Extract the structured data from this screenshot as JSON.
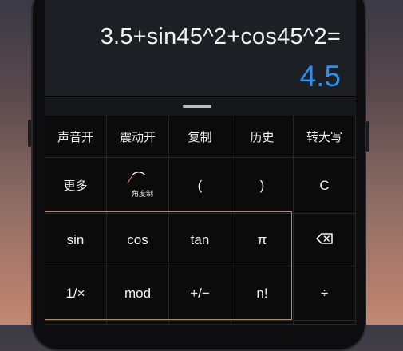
{
  "display": {
    "expression": "3.5+sin45^2+cos45^2=",
    "result": "4.5"
  },
  "toolbar": [
    "声音开",
    "震动开",
    "复制",
    "历史",
    "转大写"
  ],
  "row2": {
    "more": "更多",
    "angle_label": "角度制",
    "paren_open": "(",
    "paren_close": ")",
    "clear": "C"
  },
  "row3": {
    "sin": "sin",
    "cos": "cos",
    "tan": "tan",
    "pi": "π",
    "backspace": "⌫"
  },
  "row4": {
    "reciprocal": "1/×",
    "mod": "mod",
    "negate": "+/−",
    "factorial": "n!",
    "divide": "÷"
  },
  "colors": {
    "result": "#2d8ff0",
    "highlight_border": "#c9845a",
    "angle_accent": "#f0783a"
  }
}
